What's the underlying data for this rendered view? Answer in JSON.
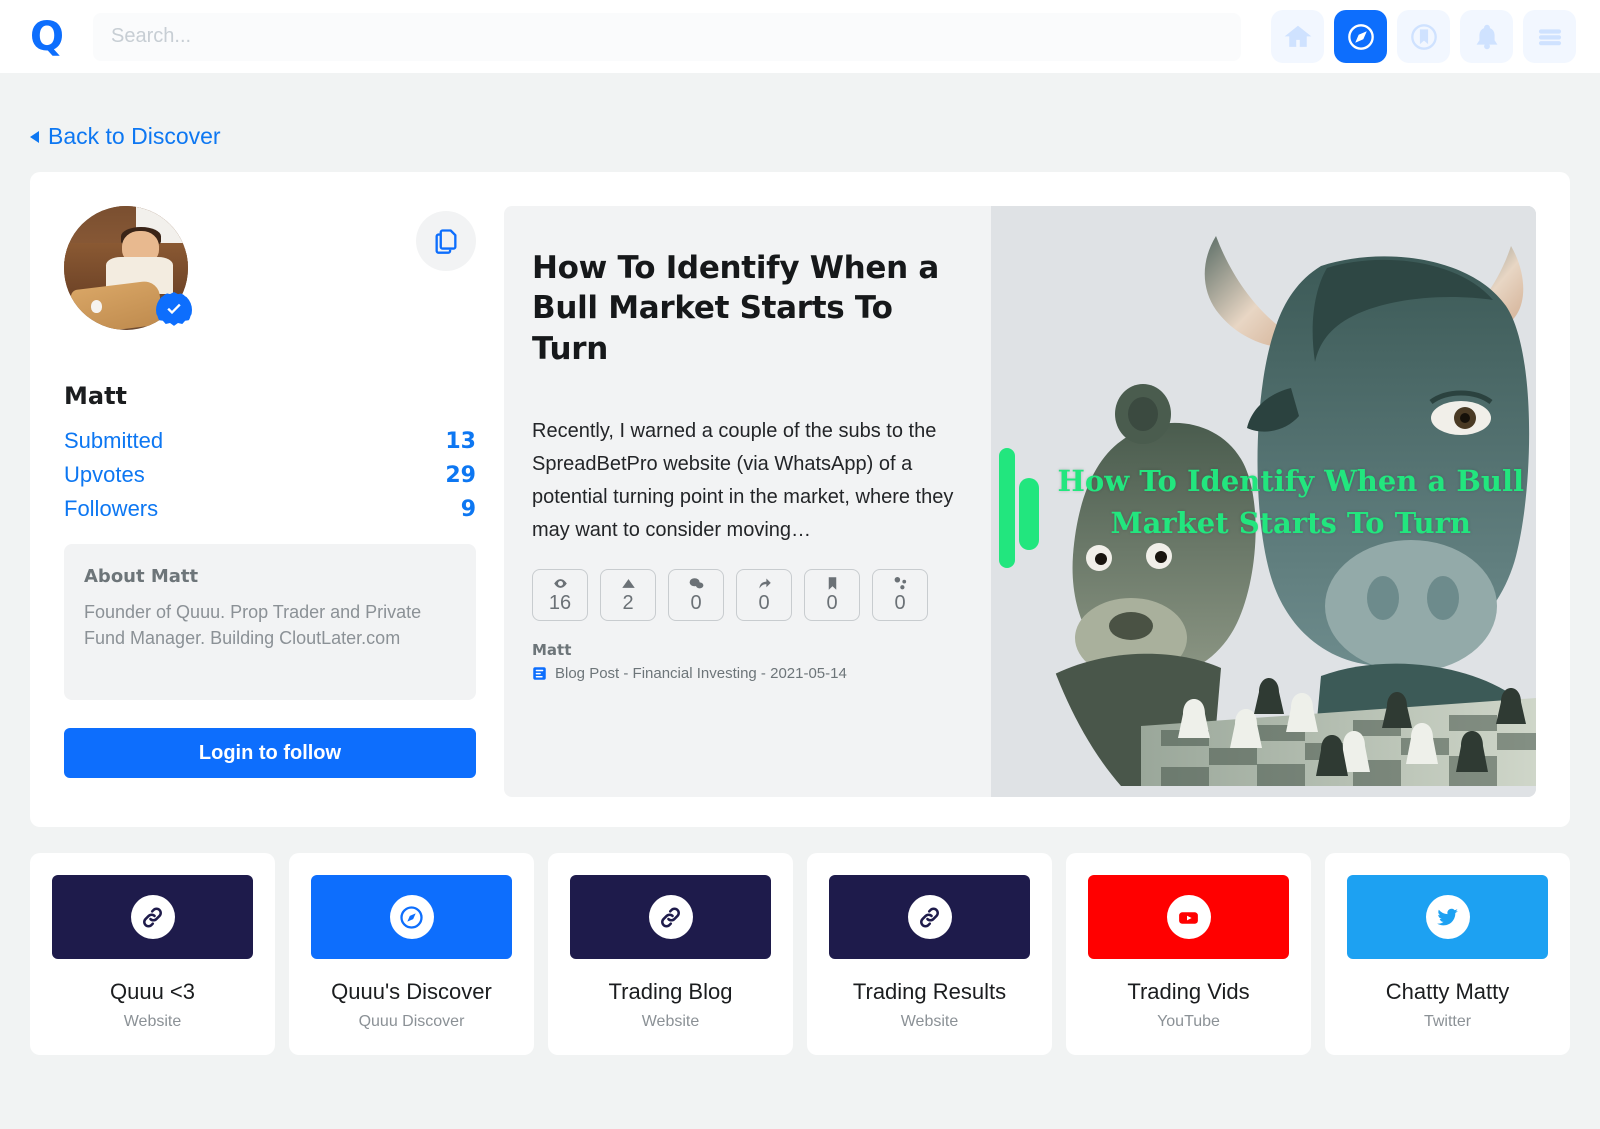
{
  "header": {
    "logo_text": "Q",
    "search": {
      "value": "",
      "placeholder": "Search..."
    },
    "nav": [
      {
        "name": "home-icon",
        "label": "Home",
        "active": false
      },
      {
        "name": "compass-icon",
        "label": "Discover",
        "active": true
      },
      {
        "name": "bookmark-circle-icon",
        "label": "Saved",
        "active": false
      },
      {
        "name": "bell-icon",
        "label": "Notifications",
        "active": false
      },
      {
        "name": "hamburger-menu-icon",
        "label": "Menu",
        "active": false
      }
    ]
  },
  "back_link": {
    "label": "Back to Discover"
  },
  "profile": {
    "name": "Matt",
    "copy_icon": "copy-icon",
    "verified": true,
    "stats": [
      {
        "label": "Submitted",
        "value": "13"
      },
      {
        "label": "Upvotes",
        "value": "29"
      },
      {
        "label": "Followers",
        "value": "9"
      }
    ],
    "about": {
      "title": "About Matt",
      "body": "Founder of Quuu. Prop Trader and Private Fund Manager. Building CloutLater.com"
    },
    "follow_button": "Login to follow"
  },
  "article": {
    "title": "How To Identify When a Bull Market Starts To Turn",
    "description": "Recently, I warned a couple of the subs to the SpreadBetPro website (via WhatsApp) of a potential turning point in the market, where they may want to consider moving…",
    "stats": [
      {
        "icon": "eye-icon",
        "value": "16"
      },
      {
        "icon": "upvote-triangle-icon",
        "value": "2"
      },
      {
        "icon": "comment-icon",
        "value": "0"
      },
      {
        "icon": "share-arrow-icon",
        "value": "0"
      },
      {
        "icon": "bookmark-icon",
        "value": "0"
      },
      {
        "icon": "share-nodes-icon",
        "value": "0"
      }
    ],
    "byline_name": "Matt",
    "byline_meta": "Blog Post - Financial Investing - 2021-05-14",
    "thumbnail_caption": "How To Identify When a Bull Market Starts To Turn",
    "thumbnail_caption_color": "#22e67e"
  },
  "link_cards": [
    {
      "title": "Quuu <3",
      "subtitle": "Website",
      "icon": "link-icon",
      "bg": "#1e1b4b"
    },
    {
      "title": "Quuu's Discover",
      "subtitle": "Quuu Discover",
      "icon": "compass-icon",
      "bg": "#0d6efd"
    },
    {
      "title": "Trading Blog",
      "subtitle": "Website",
      "icon": "link-icon",
      "bg": "#1e1b4b"
    },
    {
      "title": "Trading Results",
      "subtitle": "Website",
      "icon": "link-icon",
      "bg": "#1e1b4b"
    },
    {
      "title": "Trading Vids",
      "subtitle": "YouTube",
      "icon": "youtube-icon",
      "bg": "#ff0000"
    },
    {
      "title": "Chatty Matty",
      "subtitle": "Twitter",
      "icon": "twitter-icon",
      "bg": "#1da1f2"
    }
  ],
  "colors": {
    "accent": "#0d6efd",
    "link": "#0d77f2",
    "page_bg": "#f1f3f3",
    "panel_bg": "#f2f3f4",
    "navy": "#1e1b4b"
  }
}
